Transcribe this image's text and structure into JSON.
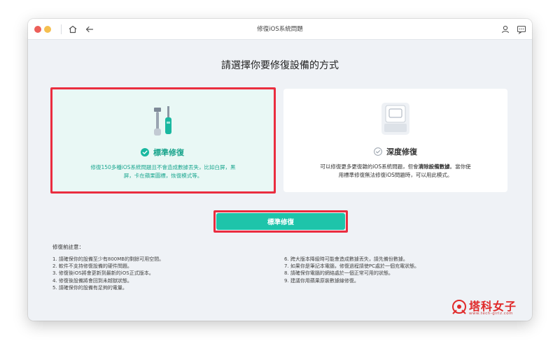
{
  "window": {
    "title": "修復iOS系統問題"
  },
  "heading": "請選擇你要修復設備的方式",
  "modes": {
    "standard": {
      "title": "標準修復",
      "description_line1": "修復150多種iOS系統問題且不會造成數據丟失，比如白屏，黑",
      "description_line2": "屏，卡在蘋果圖標，恢復模式等。",
      "selected": true
    },
    "deep": {
      "title": "深度修復",
      "description_line1_pre": "可以修復更多更復雜的iOS系統問題，但會",
      "description_line1_bold": "清除設備數據",
      "description_line1_post": "。當你使",
      "description_line2": "用標準修復無法修復iOS問題時，可以用此模式。",
      "selected": false
    }
  },
  "primary_button": "標準修復",
  "notes": {
    "title": "修復前註意：",
    "left": [
      "1. 請確保你的設備至少有800MB的剩餘可用空間。",
      "2. 軟件不支持修復設備的硬件問題。",
      "3. 修復後iOS將會更新到最新的iOS正式版本。",
      "4. 修復後設備將會回到未越獄狀態。",
      "5. 請確保你的設備有足夠的電量。"
    ],
    "right": [
      "6. 跨大版本降級時可能會造成數據丟失，請先備份數據。",
      "7. 如果你是筆記本電腦，修復過程請使PC處於一個充電狀態。",
      "8. 請確保你電腦的網絡處於一個正常可用的狀態。",
      "9. 建議你用蘋果原裝數據線修復。"
    ]
  },
  "watermark": {
    "text": "塔科女子",
    "url": "www.tech-girlz.com"
  },
  "colors": {
    "accent": "#1ec4aa",
    "highlight": "#ea2d3f",
    "selected_text": "#19a48c"
  },
  "icons": {
    "home": "home-icon",
    "back": "back-arrow-icon",
    "user": "user-icon",
    "feedback": "feedback-icon",
    "check": "check-circle-icon"
  }
}
